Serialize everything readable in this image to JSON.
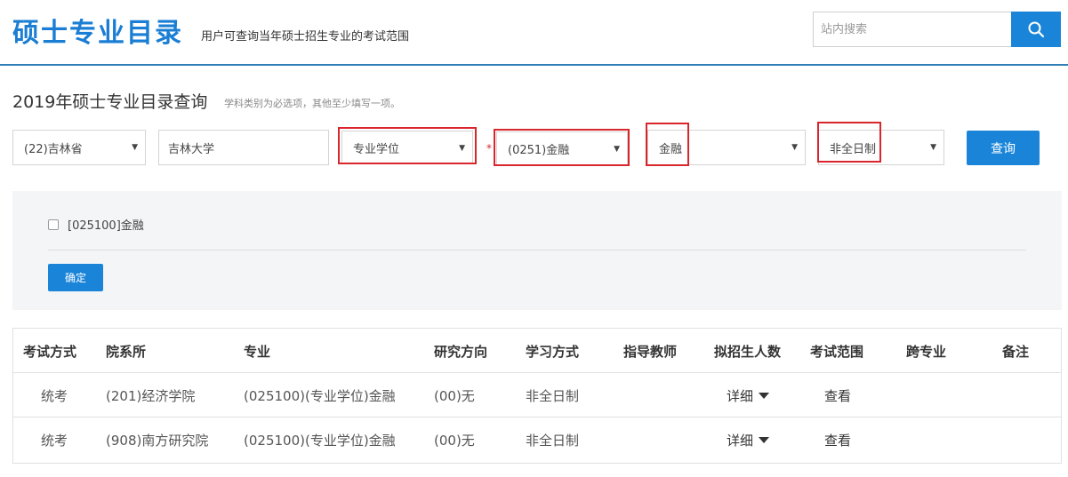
{
  "header": {
    "logo": "硕士专业目录",
    "tagline": "用户可查询当年硕士招生专业的考试范围",
    "search_placeholder": "站内搜索"
  },
  "query": {
    "title": "2019年硕士专业目录查询",
    "hint": "学科类别为必选项，其他至少填写一项。",
    "filters": {
      "province": "(22)吉林省",
      "school": "吉林大学",
      "degree_type": "专业学位",
      "required_mark": "*",
      "discipline": "(0251)金融",
      "major": "金融",
      "study_mode": "非全日制"
    },
    "query_label": "查询"
  },
  "panel": {
    "checkbox_label": "[025100]金融",
    "confirm_label": "确定"
  },
  "table": {
    "headers": [
      "考试方式",
      "院系所",
      "专业",
      "研究方向",
      "学习方式",
      "指导教师",
      "拟招生人数",
      "考试范围",
      "跨专业",
      "备注"
    ],
    "rows": [
      {
        "exam": "统考",
        "dept": "(201)经济学院",
        "major": "(025100)(专业学位)金融",
        "direction": "(00)无",
        "mode": "非全日制",
        "advisor": "",
        "quota": "详细",
        "scope": "查看",
        "cross": "",
        "note": ""
      },
      {
        "exam": "统考",
        "dept": "(908)南方研究院",
        "major": "(025100)(专业学位)金融",
        "direction": "(00)无",
        "mode": "非全日制",
        "advisor": "",
        "quota": "详细",
        "scope": "查看",
        "cross": "",
        "note": ""
      }
    ]
  },
  "colors": {
    "brand_blue": "#1a85d8",
    "highlight_red": "#d9262c"
  }
}
